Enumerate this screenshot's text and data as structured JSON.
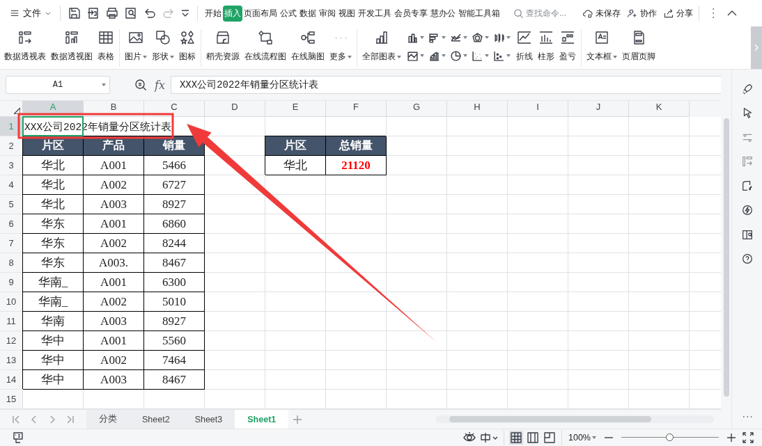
{
  "menu": {
    "file_label": "文件",
    "tabs": [
      {
        "label": "开始",
        "selected": false
      },
      {
        "label": "插入",
        "selected": true
      },
      {
        "label": "页面布局",
        "selected": false
      },
      {
        "label": "公式",
        "selected": false
      },
      {
        "label": "数据",
        "selected": false
      },
      {
        "label": "审阅",
        "selected": false
      },
      {
        "label": "视图",
        "selected": false
      },
      {
        "label": "开发工具",
        "selected": false
      },
      {
        "label": "会员专享",
        "selected": false
      },
      {
        "label": "慧办公",
        "selected": false
      },
      {
        "label": "智能工具箱",
        "selected": false
      }
    ],
    "search": {
      "placeholder": "查找命令..."
    },
    "actions": [
      "未保存",
      "协作",
      "分享"
    ]
  },
  "ribbon": {
    "groups": [
      {
        "kind": "buttons",
        "items": [
          {
            "label": "数据透视表",
            "dropdown": false
          },
          {
            "label": "数据透视图",
            "dropdown": false
          },
          {
            "label": "表格",
            "dropdown": false
          }
        ]
      },
      {
        "kind": "buttons",
        "items": [
          {
            "label": "图片",
            "dropdown": true
          },
          {
            "label": "形状",
            "dropdown": true
          },
          {
            "label": "图标",
            "dropdown": false
          }
        ]
      },
      {
        "kind": "buttons",
        "items": [
          {
            "label": "稻壳资源",
            "dropdown": false
          },
          {
            "label": "在线流程图",
            "dropdown": false
          },
          {
            "label": "在线脑图",
            "dropdown": false
          },
          {
            "label": "更多",
            "dropdown": true
          }
        ]
      },
      {
        "kind": "buttons",
        "items": [
          {
            "label": "全部图表",
            "dropdown": true
          }
        ]
      },
      {
        "kind": "chart-grid"
      },
      {
        "kind": "buttons",
        "items": [
          {
            "label": "折线",
            "dropdown": false
          },
          {
            "label": "柱形",
            "dropdown": false
          },
          {
            "label": "盈亏",
            "dropdown": false
          }
        ]
      },
      {
        "kind": "buttons",
        "items": [
          {
            "label": "文本框",
            "dropdown": true
          },
          {
            "label": "页眉页脚",
            "dropdown": false
          }
        ]
      }
    ]
  },
  "formula_bar": {
    "name_box": "A1",
    "fx": "fx",
    "value": "XXX公司2022年销量分区统计表"
  },
  "sheet": {
    "columns": [
      {
        "label": "A",
        "selected": true
      },
      {
        "label": "B",
        "selected": false
      },
      {
        "label": "C",
        "selected": false
      },
      {
        "label": "D",
        "selected": false
      },
      {
        "label": "E",
        "selected": false
      },
      {
        "label": "F",
        "selected": false
      },
      {
        "label": "G",
        "selected": false
      },
      {
        "label": "H",
        "selected": false
      },
      {
        "label": "I",
        "selected": false
      },
      {
        "label": "J",
        "selected": false
      },
      {
        "label": "K",
        "selected": false
      }
    ],
    "rows": [
      {
        "number": "1",
        "selected": true,
        "cells": [
          {
            "text": "XXX公司2022年销量分区统计表",
            "kind": "title",
            "selected": true
          }
        ]
      },
      {
        "number": "2",
        "selected": false,
        "cells": [
          {
            "text": "片区",
            "kind": "header",
            "selected": false
          },
          {
            "text": "产品",
            "kind": "header",
            "selected": false
          },
          {
            "text": "销量",
            "kind": "header",
            "selected": false
          },
          {
            "text": "",
            "kind": "empty"
          },
          {
            "text": "片区",
            "kind": "header",
            "selected": false
          },
          {
            "text": "总销量",
            "kind": "header",
            "selected": false
          }
        ]
      },
      {
        "number": "3",
        "selected": false,
        "cells": [
          {
            "text": "华北",
            "kind": "data",
            "selected": false
          },
          {
            "text": "A001",
            "kind": "data",
            "selected": false
          },
          {
            "text": "5466",
            "kind": "data",
            "selected": false
          },
          {
            "text": "",
            "kind": "empty"
          },
          {
            "text": "华北",
            "kind": "data",
            "selected": false
          },
          {
            "text": "21120",
            "kind": "total",
            "selected": false
          }
        ]
      },
      {
        "number": "4",
        "selected": false,
        "cells": [
          {
            "text": "华北",
            "kind": "data",
            "selected": false
          },
          {
            "text": "A002",
            "kind": "data",
            "selected": false
          },
          {
            "text": "6727",
            "kind": "data",
            "selected": false
          }
        ]
      },
      {
        "number": "5",
        "selected": false,
        "cells": [
          {
            "text": "华北",
            "kind": "data",
            "selected": false
          },
          {
            "text": "A003",
            "kind": "data",
            "selected": false
          },
          {
            "text": "8927",
            "kind": "data",
            "selected": false
          }
        ]
      },
      {
        "number": "6",
        "selected": false,
        "cells": [
          {
            "text": "华东",
            "kind": "data",
            "selected": false
          },
          {
            "text": "A001",
            "kind": "data",
            "selected": false
          },
          {
            "text": "6860",
            "kind": "data",
            "selected": false
          }
        ]
      },
      {
        "number": "7",
        "selected": false,
        "cells": [
          {
            "text": "华东",
            "kind": "data",
            "selected": false
          },
          {
            "text": "A002",
            "kind": "data",
            "selected": false
          },
          {
            "text": "8244",
            "kind": "data",
            "selected": false
          }
        ]
      },
      {
        "number": "8",
        "selected": false,
        "cells": [
          {
            "text": "华东",
            "kind": "data",
            "selected": false
          },
          {
            "text": "A003.",
            "kind": "data",
            "selected": false
          },
          {
            "text": "8467",
            "kind": "data",
            "selected": false
          }
        ]
      },
      {
        "number": "9",
        "selected": false,
        "cells": [
          {
            "text": "华南_",
            "kind": "data",
            "selected": false
          },
          {
            "text": "A001",
            "kind": "data",
            "selected": false
          },
          {
            "text": "6300",
            "kind": "data",
            "selected": false
          }
        ]
      },
      {
        "number": "10",
        "selected": false,
        "cells": [
          {
            "text": "华南_",
            "kind": "data",
            "selected": false
          },
          {
            "text": "A002",
            "kind": "data",
            "selected": false
          },
          {
            "text": "5010",
            "kind": "data",
            "selected": false
          }
        ]
      },
      {
        "number": "11",
        "selected": false,
        "cells": [
          {
            "text": "华南",
            "kind": "data",
            "selected": false
          },
          {
            "text": "A003",
            "kind": "data",
            "selected": false
          },
          {
            "text": "8927",
            "kind": "data",
            "selected": false
          }
        ]
      },
      {
        "number": "12",
        "selected": false,
        "cells": [
          {
            "text": "华中",
            "kind": "data",
            "selected": false
          },
          {
            "text": "A001",
            "kind": "data",
            "selected": false
          },
          {
            "text": "5560",
            "kind": "data",
            "selected": false
          }
        ]
      },
      {
        "number": "13",
        "selected": false,
        "cells": [
          {
            "text": "华中",
            "kind": "data",
            "selected": false
          },
          {
            "text": "A002",
            "kind": "data",
            "selected": false
          },
          {
            "text": "7464",
            "kind": "data",
            "selected": false
          }
        ]
      },
      {
        "number": "14",
        "selected": false,
        "cells": [
          {
            "text": "华中",
            "kind": "data",
            "selected": false
          },
          {
            "text": "A003",
            "kind": "data",
            "selected": false
          },
          {
            "text": "8467",
            "kind": "data",
            "selected": false
          }
        ]
      },
      {
        "number": "15",
        "selected": false
      }
    ]
  },
  "sheet_tabs": [
    {
      "label": "分类",
      "selected": false
    },
    {
      "label": "Sheet2",
      "selected": false
    },
    {
      "label": "Sheet3",
      "selected": false
    },
    {
      "label": "Sheet1",
      "selected": true
    }
  ],
  "status_bar": {
    "zoom": "100%",
    "zoom_slider": {
      "level": 0.5
    }
  }
}
